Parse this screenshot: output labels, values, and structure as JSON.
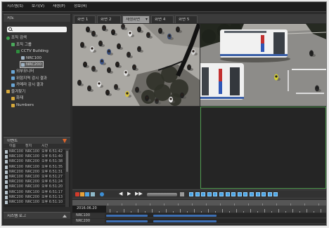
{
  "window": {
    "menu": [
      "시스템(S)",
      "보기(V)",
      "재생(P)",
      "정보(H)"
    ]
  },
  "map_panel": {
    "title": "지도",
    "search": {
      "value": "",
      "icon": "search-icon"
    },
    "tree": [
      {
        "label": "조직 검색",
        "icon": "globe-icon",
        "level": 0
      },
      {
        "label": "조직 그룹",
        "icon": "group-icon",
        "level": 1
      },
      {
        "label": "CCTV Building",
        "icon": "building-icon",
        "level": 2
      },
      {
        "label": "NRC100",
        "icon": "camera-icon",
        "level": 3
      },
      {
        "label": "NRC200",
        "icon": "camera-icon",
        "level": 3,
        "selected": true
      },
      {
        "label": "외부모니터",
        "icon": "monitor-icon",
        "level": 1
      },
      {
        "label": "위험지역 감시 결과",
        "icon": "monitor-icon",
        "level": 1
      },
      {
        "label": "카메라 감시 결과",
        "icon": "monitor-icon",
        "level": 1
      },
      {
        "label": "즐겨찾기",
        "icon": "folder-icon",
        "level": 0
      },
      {
        "label": "화재",
        "icon": "folder-icon",
        "level": 1
      },
      {
        "label": "Numbers",
        "icon": "folder-icon",
        "level": 1
      }
    ]
  },
  "event_panel": {
    "title": "이벤트",
    "icon": "alert-icon",
    "columns": [
      "이름",
      "장치",
      "시간"
    ],
    "rows": [
      [
        "NRC100",
        "NRC100",
        "오후 6:51:42"
      ],
      [
        "NRC100",
        "NRC100",
        "오후 6:51:40"
      ],
      [
        "NRC200",
        "NRC200",
        "오후 6:51:38"
      ],
      [
        "NRC100",
        "NRC100",
        "오후 6:51:35"
      ],
      [
        "NRC200",
        "NRC200",
        "오후 6:51:31"
      ],
      [
        "NRC100",
        "NRC100",
        "오후 6:51:27"
      ],
      [
        "NRC200",
        "NRC200",
        "오후 6:51:24"
      ],
      [
        "NRC100",
        "NRC100",
        "오후 6:51:20"
      ],
      [
        "NRC100",
        "NRC100",
        "오후 6:51:17"
      ],
      [
        "NRC200",
        "NRC200",
        "오후 6:51:13"
      ],
      [
        "NRC100",
        "NRC100",
        "오후 6:51:10"
      ]
    ]
  },
  "log_panel": {
    "title": "시스템 로그",
    "icon": "chevron-up-icon"
  },
  "view_tabs": [
    {
      "label": "화면 1"
    },
    {
      "label": "화면 2"
    },
    {
      "label": "재생화면",
      "active": true
    },
    {
      "label": "화면 4"
    },
    {
      "label": "화면 5"
    }
  ],
  "video": {
    "selected_cell": 4
  },
  "toolbar": {
    "icons": [
      "record-icon",
      "snapshot-icon",
      "export-icon",
      "bookmark-icon",
      "sync-icon",
      "step-back-icon",
      "play-icon",
      "step-forward-icon",
      "speed-slider",
      "audio-icon",
      "layout-1-icon",
      "layout-4-icon",
      "layout-6-icon",
      "layout-8-icon",
      "layout-9-icon",
      "layout-10-icon",
      "layout-13-icon",
      "layout-16-icon",
      "layout-20-icon",
      "layout-25-icon",
      "layout-36-icon",
      "fullscreen-icon",
      "sequence-icon",
      "prev-page-icon",
      "next-page-icon"
    ]
  },
  "timeline": {
    "date": "2016.06.20",
    "channels": [
      {
        "name": "NRC100"
      },
      {
        "name": "NRC200"
      }
    ]
  },
  "colors": {
    "selected_cell_border": "#4f9a4f",
    "recording_segment": "#3d6fb4",
    "record_button": "#d23b2b",
    "active_tab": "#9a9a9a"
  }
}
